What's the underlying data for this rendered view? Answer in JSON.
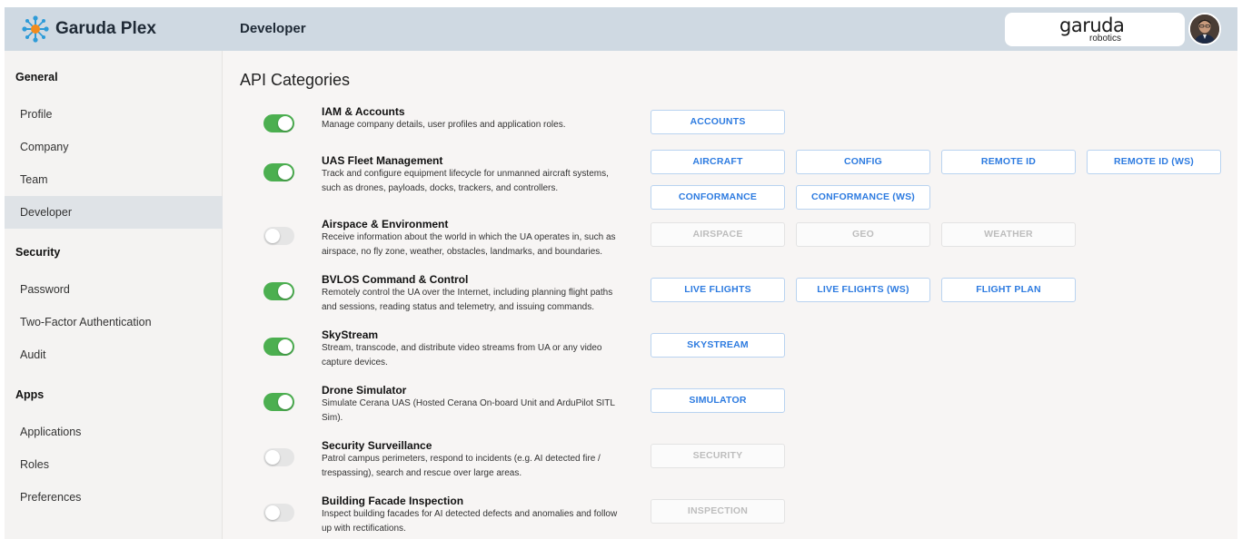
{
  "app": {
    "name": "Garuda Plex"
  },
  "header": {
    "page_title": "Developer",
    "company_logo_text": "garuda",
    "company_logo_sub": "robotics"
  },
  "sidebar": {
    "groups": [
      {
        "label": "General",
        "items": [
          {
            "label": "Profile"
          },
          {
            "label": "Company"
          },
          {
            "label": "Team"
          },
          {
            "label": "Developer",
            "active": true
          }
        ]
      },
      {
        "label": "Security",
        "items": [
          {
            "label": "Password"
          },
          {
            "label": "Two-Factor Authentication"
          },
          {
            "label": "Audit"
          }
        ]
      },
      {
        "label": "Apps",
        "items": [
          {
            "label": "Applications"
          },
          {
            "label": "Roles"
          },
          {
            "label": "Preferences"
          }
        ]
      }
    ]
  },
  "main": {
    "title": "API Categories",
    "categories": [
      {
        "title": "IAM & Accounts",
        "enabled": true,
        "desc1": "Manage company details, user profiles and application roles.",
        "desc2": "",
        "buttons": [
          "ACCOUNTS"
        ]
      },
      {
        "title": "UAS Fleet Management",
        "enabled": true,
        "desc1": "Track and configure equipment lifecycle for unmanned aircraft systems,",
        "desc2": "such as drones, payloads, docks, trackers, and controllers.",
        "buttons": [
          "AIRCRAFT",
          "CONFIG",
          "REMOTE ID",
          "REMOTE ID (WS)",
          "CONFORMANCE",
          "CONFORMANCE (WS)"
        ]
      },
      {
        "title": "Airspace & Environment",
        "enabled": false,
        "desc1": "Receive information about the world in which the UA operates in, such as",
        "desc2": "airspace, no fly zone, weather, obstacles, landmarks, and boundaries.",
        "buttons": [
          "AIRSPACE",
          "GEO",
          "WEATHER"
        ]
      },
      {
        "title": "BVLOS Command & Control",
        "enabled": true,
        "desc1": "Remotely control the UA over the Internet, including planning flight paths",
        "desc2": "and sessions, reading status and telemetry, and issuing commands.",
        "buttons": [
          "LIVE FLIGHTS",
          "LIVE FLIGHTS (WS)",
          "FLIGHT PLAN"
        ]
      },
      {
        "title": "SkyStream",
        "enabled": true,
        "desc1": "Stream, transcode, and distribute video streams from UA or any video",
        "desc2": "capture devices.",
        "buttons": [
          "SKYSTREAM"
        ]
      },
      {
        "title": "Drone Simulator",
        "enabled": true,
        "desc1": "Simulate Cerana UAS (Hosted Cerana On-board Unit and ArduPilot SITL",
        "desc2": "Sim).",
        "buttons": [
          "SIMULATOR"
        ]
      },
      {
        "title": "Security Surveillance",
        "enabled": false,
        "desc1": "Patrol campus perimeters, respond to incidents (e.g. AI detected fire /",
        "desc2": "trespassing), search and rescue over large areas.",
        "buttons": [
          "SECURITY"
        ]
      },
      {
        "title": "Building Facade Inspection",
        "enabled": false,
        "desc1": "Inspect building facades for AI detected defects and anomalies and follow",
        "desc2": "up with rectifications.",
        "buttons": [
          "INSPECTION"
        ]
      }
    ]
  },
  "colors": {
    "header_bg": "#cfd9e2",
    "accent": "#2d7be0",
    "toggle_on": "#4caf50",
    "toggle_off": "#e5e5e5",
    "active_nav": "#dfe3e7"
  }
}
